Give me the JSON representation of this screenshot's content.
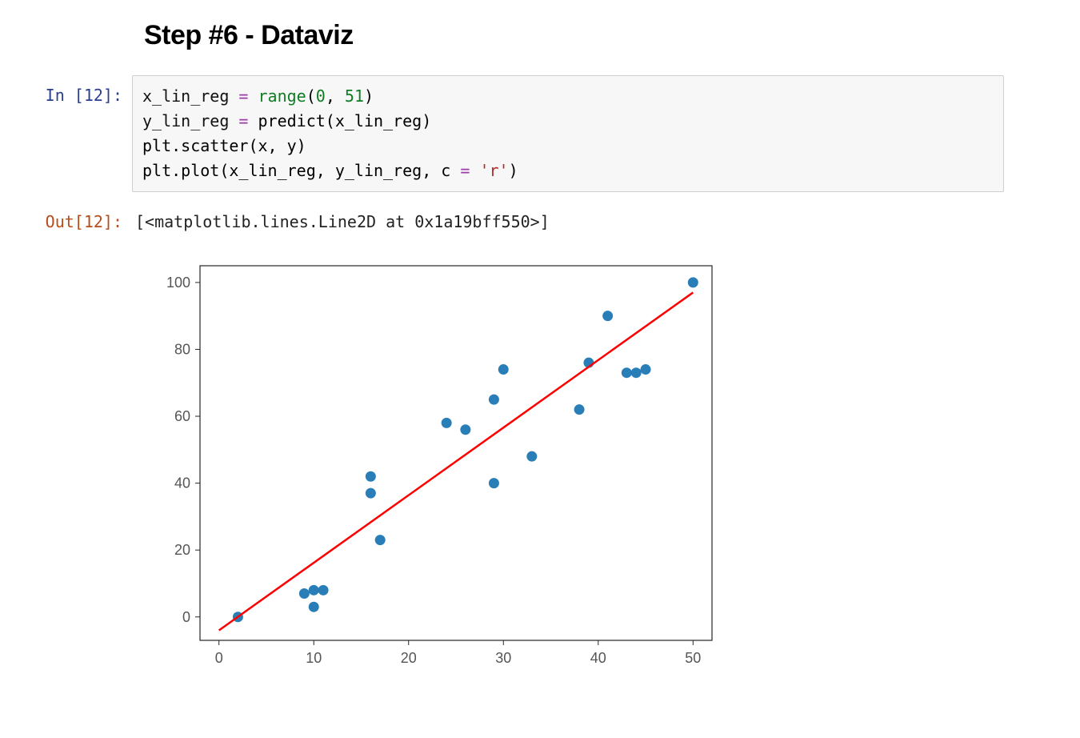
{
  "heading": "Step #6 - Dataviz",
  "prompt_in": "In [12]:",
  "prompt_out": "Out[12]:",
  "code": {
    "line1": {
      "v1": "x_lin_reg",
      "eq": " = ",
      "fn": "range",
      "p1": "(",
      "n1": "0",
      "c": ", ",
      "n2": "51",
      "p2": ")"
    },
    "line2": {
      "v1": "y_lin_reg",
      "eq": " = ",
      "fn": "predict(x_lin_reg)"
    },
    "line3": "plt.scatter(x, y)",
    "line4": {
      "a": "plt.plot(x_lin_reg, y_lin_reg, c ",
      "eq": "=",
      "sp": " ",
      "s": "'r'",
      "b": ")"
    }
  },
  "output_text": "[<matplotlib.lines.Line2D at 0x1a19bff550>]",
  "chart_data": {
    "type": "scatter",
    "xlim": [
      -2,
      52
    ],
    "ylim": [
      -7,
      105
    ],
    "xticks": [
      0,
      10,
      20,
      30,
      40,
      50
    ],
    "yticks": [
      0,
      20,
      40,
      60,
      80,
      100
    ],
    "series": [
      {
        "name": "scatter",
        "color": "#1f77b4",
        "x": [
          2,
          9,
          10,
          10,
          11,
          16,
          16,
          17,
          24,
          26,
          29,
          29,
          30,
          33,
          38,
          39,
          41,
          43,
          44,
          45,
          50
        ],
        "y": [
          0,
          7,
          3,
          8,
          8,
          37,
          42,
          23,
          58,
          56,
          40,
          65,
          74,
          48,
          62,
          76,
          90,
          73,
          73,
          74,
          100
        ]
      },
      {
        "name": "regression_line",
        "color": "red",
        "x": [
          0,
          50
        ],
        "y": [
          -4,
          97
        ]
      }
    ]
  }
}
